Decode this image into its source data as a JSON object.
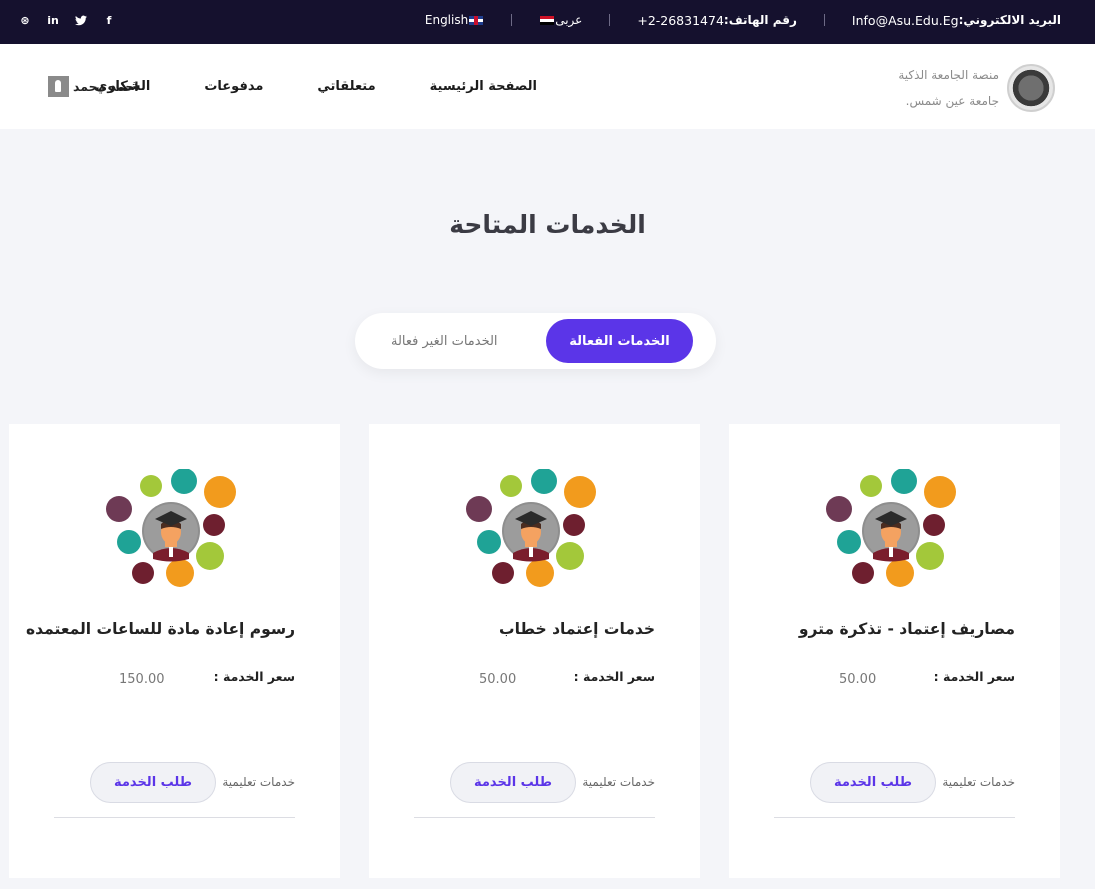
{
  "topbar": {
    "social": [
      "dribbble-icon",
      "linkedin-icon",
      "twitter-icon",
      "facebook-icon"
    ],
    "social_glyphs": [
      "⊛",
      "in",
      "🐦",
      "f"
    ],
    "email_label": "البريد الالكتروني:",
    "email_value": "Info@Asu.Edu.Eg",
    "phone_label": "رقم الهاتف:",
    "phone_value": "+2-26831474",
    "lang_ar": "عربى",
    "lang_en": "English"
  },
  "header": {
    "brand_line1": "منصة الجامعة الذكية",
    "brand_line2": "جامعة عين شمس.",
    "nav": [
      "الصفحة الرئيسية",
      "متعلقاتي",
      "مدفوعات",
      "الشكاوي"
    ],
    "user_name": "احمد محمد"
  },
  "page": {
    "title": "الخدمات المتاحة",
    "tab_active": "الخدمات الفعالة",
    "tab_inactive": "الخدمات الغير فعالة"
  },
  "cards": [
    {
      "name": "مصاريف إعتماد - تذكرة مترو",
      "price_label": "سعر الخدمة :",
      "price": "50.00",
      "category": "خدمات تعليمية",
      "button": "طلب الخدمة"
    },
    {
      "name": "خدمات إعتماد خطاب",
      "price_label": "سعر الخدمة :",
      "price": "50.00",
      "category": "خدمات تعليمية",
      "button": "طلب الخدمة"
    },
    {
      "name": "رسوم إعادة مادة للساعات المعتمده",
      "price_label": "سعر الخدمة :",
      "price": "150.00",
      "category": "خدمات تعليمية",
      "button": "طلب الخدمة"
    }
  ],
  "colors": {
    "topbar": "#15112e",
    "accent": "#5b35e8",
    "page_bg": "#f4f5f9"
  }
}
